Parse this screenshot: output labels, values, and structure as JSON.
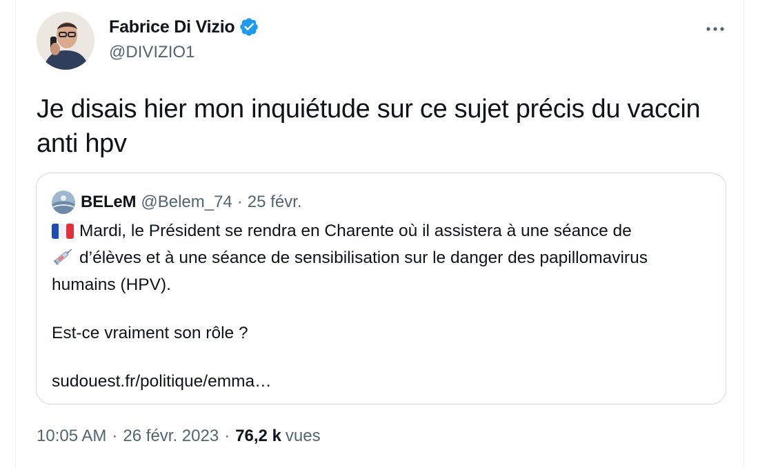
{
  "author": {
    "name": "Fabrice Di Vizio",
    "handle": "@DIVIZIO1",
    "verified": true
  },
  "tweet": {
    "text": "Je disais hier mon inquiétude sur ce sujet précis du vaccin anti hpv"
  },
  "quoted": {
    "name": "BELeM",
    "handle": "@Belem_74",
    "separator": "·",
    "date": "25 févr.",
    "line1": "Mardi, le Président se rendra en Charente où il assistera à une séance de",
    "line2": "d’élèves et à une séance de sensibilisation sur le danger des papillomavirus",
    "line3": "humains (HPV).",
    "question": "Est-ce vraiment son rôle ?",
    "link": "sudouest.fr/politique/emma…",
    "emojis": [
      "flag-france-icon",
      "syringe-icon"
    ]
  },
  "meta": {
    "time": "10:05 AM",
    "separator": "·",
    "date": "26 févr. 2023",
    "views_count": "76,2 k",
    "views_label": "vues"
  },
  "colors": {
    "verified_blue": "#1d9bf0",
    "secondary_text": "#536471",
    "border": "#cfd9de"
  }
}
